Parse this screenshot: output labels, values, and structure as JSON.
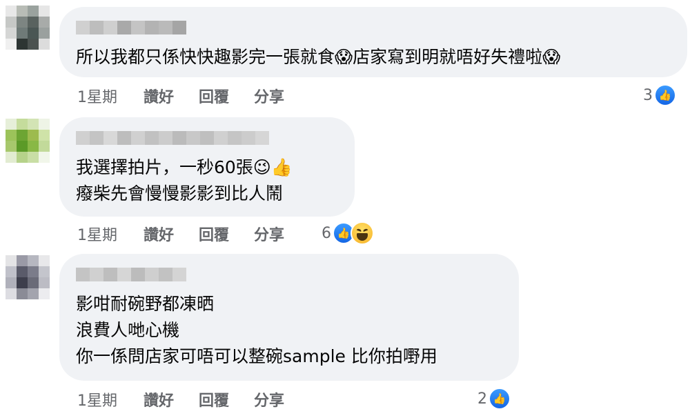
{
  "comments": [
    {
      "lines": [
        "所以我都只係快快趣影完一張就食😱店家寫到明就唔好失禮啦😱"
      ],
      "time": "1星期",
      "like_label": "讚好",
      "reply_label": "回覆",
      "share_label": "分享",
      "reaction_count": "3",
      "reactions": [
        "like-icon"
      ]
    },
    {
      "lines": [
        "我選擇拍片，一秒60張😉👍",
        "癈柴先會慢慢影影到比人鬧"
      ],
      "time": "1星期",
      "like_label": "讚好",
      "reply_label": "回覆",
      "share_label": "分享",
      "reaction_count": "6",
      "reactions": [
        "like-icon",
        "haha-icon"
      ]
    },
    {
      "lines": [
        "影咁耐碗野都凍晒",
        "浪費人哋心機",
        "你一係問店家可唔可以整碗sample 比你拍嘢用"
      ],
      "time": "1星期",
      "like_label": "讚好",
      "reply_label": "回覆",
      "share_label": "分享",
      "reaction_count": "2",
      "reactions": [
        "like-icon"
      ]
    }
  ],
  "colors": {
    "bubble": "#f0f2f5",
    "meta_text": "#65676b",
    "like_blue": "#1877f2"
  }
}
